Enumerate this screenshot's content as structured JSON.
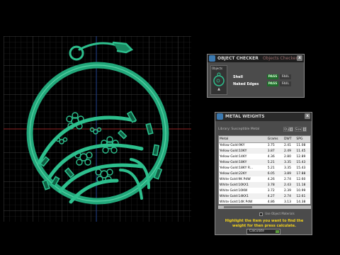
{
  "checker": {
    "title": "OBJECT CHECKER",
    "subtitle": "Objects Checker",
    "close_glyph": "x",
    "objects_label": "Objects",
    "rows": [
      {
        "name": "Shell",
        "pass": "PASS",
        "fail": "FAIL"
      },
      {
        "name": "Naked Edges",
        "pass": "PASS",
        "fail": "FAIL"
      }
    ]
  },
  "weights": {
    "title": "METAL WEIGHTS",
    "close_glyph": "x",
    "library_label": "Library: Susceptible Metal",
    "qty_label": "Qty",
    "qty_value": "1",
    "size_label": "Size",
    "size_value": "1",
    "columns": [
      "Metal",
      "Grams",
      "DWT",
      "SPG"
    ],
    "rows": [
      [
        "Yellow Gold:9KY",
        "3.75",
        "2.41",
        "11.08"
      ],
      [
        "Yellow Gold:10KY",
        "3.87",
        "2.49",
        "11.45"
      ],
      [
        "Yellow Gold:14KY",
        "4.36",
        "2.80",
        "12.89"
      ],
      [
        "Yellow Gold:18KY",
        "5.21",
        "3.35",
        "15.43"
      ],
      [
        "Yellow Gold:18KY R...",
        "5.21",
        "3.35",
        "15.43"
      ],
      [
        "Yellow Gold:22KY",
        "6.05",
        "3.89",
        "17.88"
      ],
      [
        "White Gold:9K PdW",
        "4.26",
        "2.74",
        "12.60"
      ],
      [
        "White Gold:10KX1",
        "3.78",
        "2.43",
        "11.18"
      ],
      [
        "White Gold:10KW",
        "3.72",
        "2.39",
        "10.99"
      ],
      [
        "White Gold:14KX1",
        "4.27",
        "2.74",
        "12.61"
      ],
      [
        "White Gold:14K PdW",
        "4.86",
        "3.13",
        "14.38"
      ]
    ],
    "options_label": "Use Object Materials",
    "hint": "Highlight the item you want to find the weight for then press calculate.",
    "calculate_label": "Calculate"
  }
}
